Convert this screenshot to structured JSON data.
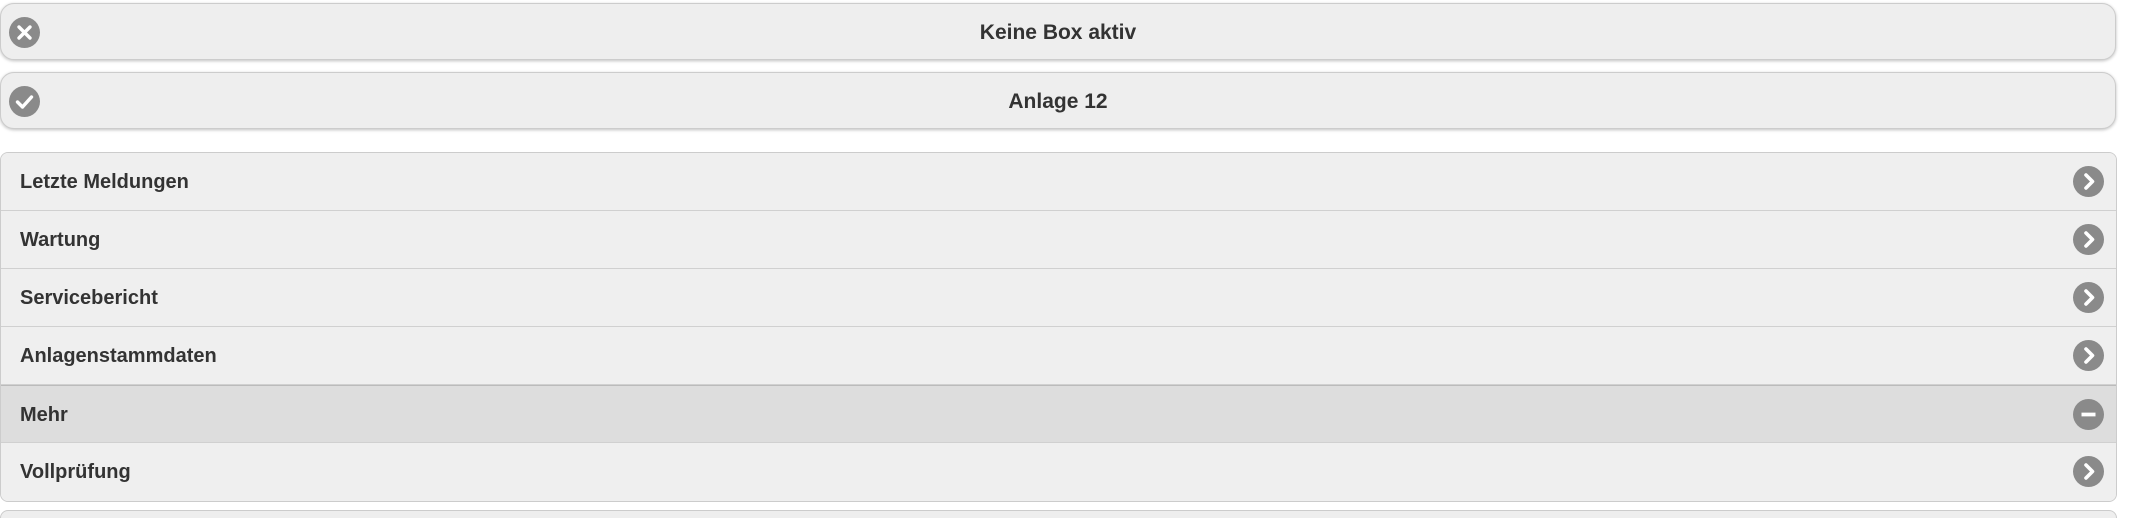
{
  "status": {
    "box": {
      "label": "Keine Box aktiv",
      "icon": "close-circle-icon"
    },
    "anlage": {
      "label": "Anlage 12",
      "icon": "check-circle-icon"
    }
  },
  "menu": {
    "items": [
      {
        "label": "Letzte Meldungen",
        "icon": "chevron-right-icon",
        "active": false
      },
      {
        "label": "Wartung",
        "icon": "chevron-right-icon",
        "active": false
      },
      {
        "label": "Servicebericht",
        "icon": "chevron-right-icon",
        "active": false
      },
      {
        "label": "Anlagenstammdaten",
        "icon": "chevron-right-icon",
        "active": false
      },
      {
        "label": "Mehr",
        "icon": "minus-circle-icon",
        "active": true
      },
      {
        "label": "Vollprüfung",
        "icon": "chevron-right-icon",
        "active": false
      }
    ]
  },
  "colors": {
    "icon_bg": "#8a8a8a",
    "button_bg": "#eeeeee",
    "active_bg": "#dddddd",
    "text": "#333333"
  }
}
